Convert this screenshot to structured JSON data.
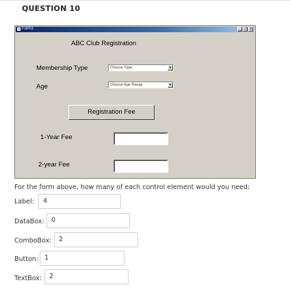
{
  "question": {
    "title": "QUESTION 10"
  },
  "window": {
    "title": "Form1",
    "buttons": [
      "_",
      "□",
      "x"
    ],
    "heading": "ABC Club Registration",
    "membership_label": "Membership Type",
    "membership_combo": "Choose Type",
    "age_label": "Age",
    "age_combo": "Choose Age Range",
    "fee_button": "Registration Fee",
    "one_year_label": "1-Year Fee",
    "two_year_label": "2-year Fee"
  },
  "prompt": "For the form above, how many of each control element would you need:",
  "answers": [
    {
      "label": "Label:",
      "value": "4"
    },
    {
      "label": "DataBox:",
      "value": "0"
    },
    {
      "label": "ComboBox:",
      "value": "2"
    },
    {
      "label": "Button:",
      "value": "1"
    },
    {
      "label": "TextBox:",
      "value": "2"
    }
  ]
}
